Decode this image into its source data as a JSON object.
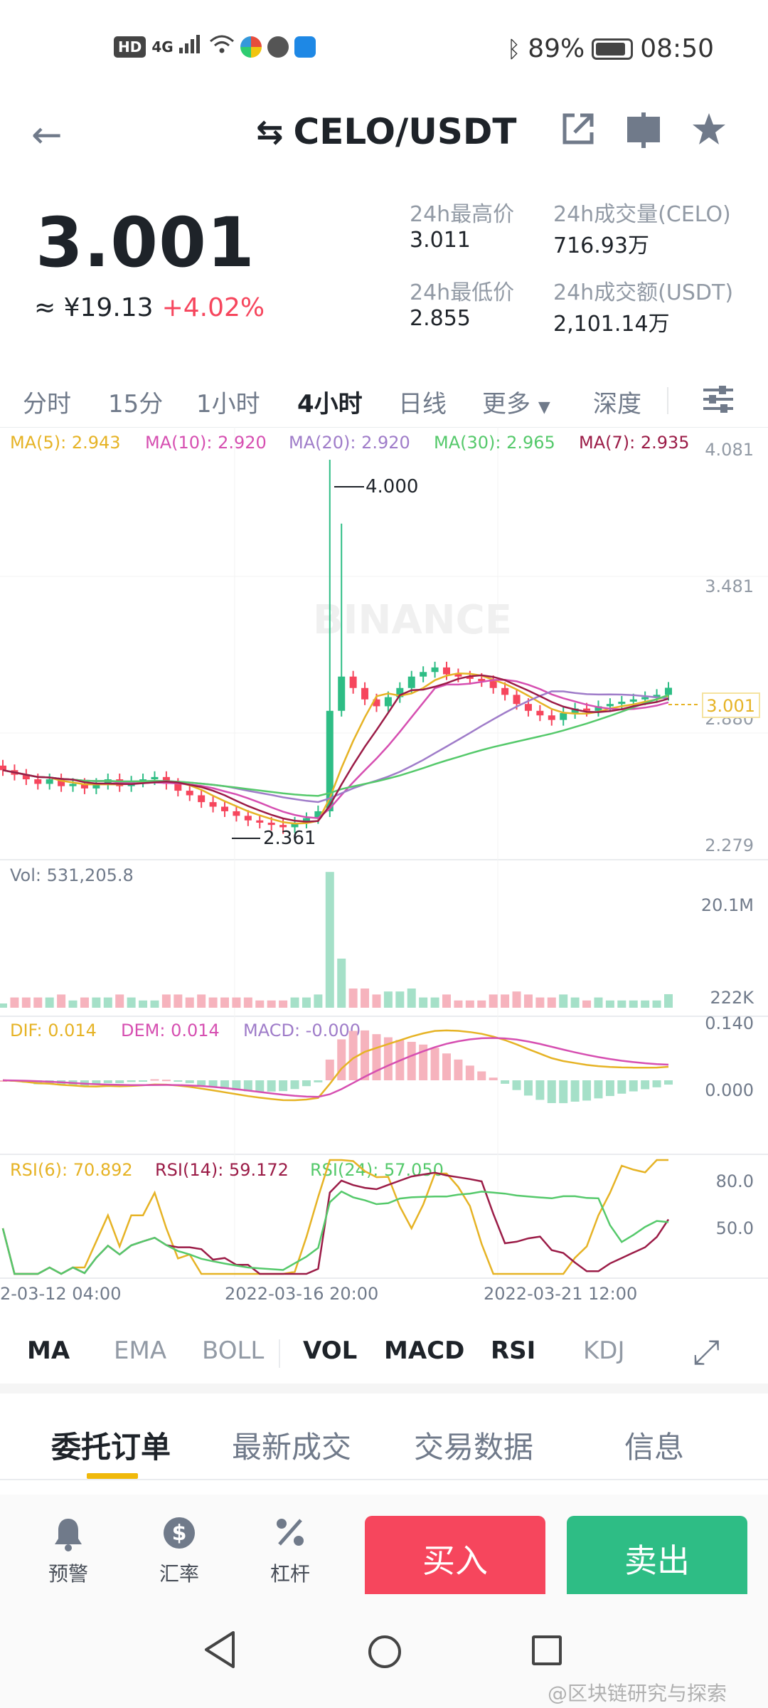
{
  "status_bar": {
    "left_badges": [
      "HD",
      "4G"
    ],
    "battery_percent_text": "89%",
    "battery_level": 0.89,
    "time": "08:50",
    "icons": [
      "signal-icon",
      "wifi-icon",
      "app-icon-1",
      "app-icon-2",
      "app-icon-3",
      "bluetooth-icon",
      "battery-icon"
    ]
  },
  "header": {
    "back_icon": "arrow-left-icon",
    "swap_icon": "swap-icon",
    "pair": "CELO/USDT",
    "share_icon": "share-icon",
    "layout_icon": "split-view-icon",
    "favorite_icon": "star-icon"
  },
  "ticker": {
    "price": "3.001",
    "fiat": "≈ ¥19.13",
    "change": "+4.02%",
    "high_label": "24h最高价",
    "high_value": "3.011",
    "low_label": "24h最低价",
    "low_value": "2.855",
    "vol_label": "24h成交量(CELO)",
    "vol_value": "716.93万",
    "amount_label": "24h成交额(USDT)",
    "amount_value": "2,101.14万"
  },
  "intervals": {
    "items": [
      "分时",
      "15分",
      "1小时",
      "4小时",
      "日线",
      "更多",
      "深度"
    ],
    "active": "4小时",
    "more_caret": "▼",
    "settings_icon": "sliders-icon"
  },
  "chart_labels": {
    "ma5": "MA(5): 2.943",
    "ma10": "MA(10): 2.920",
    "ma20": "MA(20): 2.920",
    "ma30": "MA(30): 2.965",
    "ma7": "MA(7): 2.935",
    "price_axis": [
      "4.081",
      "3.481",
      "2.880",
      "2.279"
    ],
    "current_price_tag": "3.001",
    "high_marker": "4.000",
    "low_marker": "2.361",
    "watermark": "BINANCE",
    "vol": "Vol: 531,205.8",
    "vol_axis": [
      "20.1M",
      "222K"
    ],
    "dif": "DIF: 0.014",
    "dem": "DEM: 0.014",
    "macd": "MACD: -0.000",
    "macd_axis": [
      "0.140",
      "0.000"
    ],
    "rsi6": "RSI(6): 70.892",
    "rsi14": "RSI(14): 59.172",
    "rsi24": "RSI(24): 57.050",
    "rsi_axis": [
      "80.0",
      "50.0"
    ],
    "time_axis": [
      "2-03-12 04:00",
      "2022-03-16 20:00",
      "2022-03-21 12:00"
    ]
  },
  "colors": {
    "up": "#2ebd85",
    "down": "#f6465d",
    "ma5": "#e6b325",
    "ma10": "#d64fb1",
    "ma20": "#9f7cc9",
    "ma30": "#55c96b",
    "ma7": "#9b1c47",
    "accent": "#f0b90b"
  },
  "chart_data": {
    "type": "candlestick",
    "interval": "4小时",
    "y_range": [
      2.279,
      4.081
    ],
    "high": 4.0,
    "low": 2.361,
    "last": 3.001,
    "close_series": [
      2.64,
      2.62,
      2.6,
      2.58,
      2.6,
      2.57,
      2.58,
      2.56,
      2.58,
      2.6,
      2.57,
      2.59,
      2.6,
      2.61,
      2.58,
      2.55,
      2.53,
      2.5,
      2.48,
      2.46,
      2.44,
      2.42,
      2.41,
      2.4,
      2.39,
      2.41,
      2.43,
      2.46,
      2.9,
      3.05,
      3.0,
      2.95,
      2.92,
      2.96,
      3.0,
      3.05,
      3.07,
      3.09,
      3.06,
      3.05,
      3.04,
      3.03,
      3.0,
      2.97,
      2.93,
      2.9,
      2.88,
      2.86,
      2.89,
      2.91,
      2.9,
      2.92,
      2.93,
      2.94,
      2.95,
      2.96,
      2.97,
      3.001
    ],
    "volume_axis": [
      "20.1M",
      "222K"
    ],
    "macd_axis": [
      0.14,
      0.0
    ],
    "rsi_axis": [
      80.0,
      50.0
    ],
    "rsi_last": {
      "rsi6": 70.892,
      "rsi14": 59.172,
      "rsi24": 57.05
    }
  },
  "indicators": {
    "items": [
      "MA",
      "EMA",
      "BOLL",
      "VOL",
      "MACD",
      "RSI",
      "KDJ"
    ],
    "active": [
      "MA",
      "VOL",
      "MACD",
      "RSI"
    ],
    "expand_icon": "expand-icon"
  },
  "bottom_tabs": {
    "items": [
      "委托订单",
      "最新成交",
      "交易数据",
      "信息"
    ],
    "active": "委托订单"
  },
  "actions": {
    "alert": "预警",
    "rate": "汇率",
    "leverage": "杠杆",
    "buy": "买入",
    "sell": "卖出",
    "alert_icon": "bell-icon",
    "rate_icon": "dollar-icon",
    "leverage_icon": "percent-icon"
  },
  "navbar": {
    "watermark": "@区块链研究与探索"
  }
}
